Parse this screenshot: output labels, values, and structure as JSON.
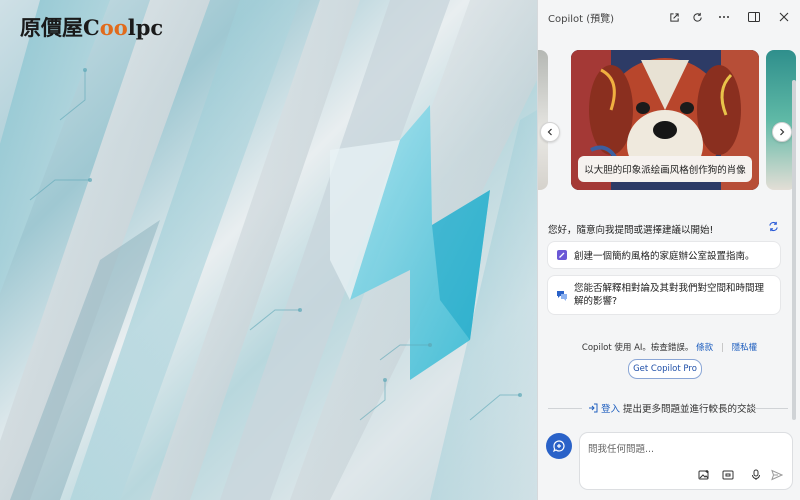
{
  "desktop": {
    "logo_text_pre": "原價屋C",
    "logo_text_oo": "oo",
    "logo_text_post": "lpc"
  },
  "panel": {
    "title": "Copilot (預覽)",
    "titlebar_icons": [
      "open-external-icon",
      "refresh-icon",
      "more-icon",
      "split-view-icon",
      "close-icon"
    ],
    "carousel": {
      "main_caption": "以大胆的印象派绘画风格创作狗的肖像"
    },
    "greeting": "您好，隨意向我提問或選擇建議以開始!",
    "suggestions": [
      {
        "icon": "pencil-icon",
        "text": "創建一個簡約風格的家庭辦公室設置指南。"
      },
      {
        "icon": "chat-bubble-icon",
        "text": "您能否解釋相對論及其對我們對空間和時間理解的影響?"
      }
    ],
    "disclaimer_text": "Copilot 使用 AI。檢查錯誤。",
    "disclaimer_link1": "條款",
    "disclaimer_link2": "隱私權",
    "pro_button": "Get Copilot Pro",
    "signin_link": "登入",
    "signin_text": "提出更多問題並進行較長的交談",
    "composer_placeholder": "問我任何問題..."
  },
  "colors": {
    "accent": "#2a62c8",
    "link": "#1f5fbf",
    "logo_accent": "#e06b1c"
  }
}
